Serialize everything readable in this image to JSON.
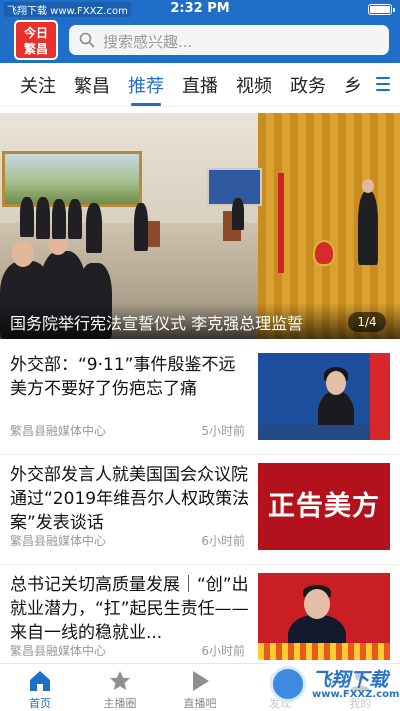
{
  "status_bar": {
    "watermark": "飞翔下载 www.FXXZ.com",
    "time": "2:32 PM"
  },
  "header": {
    "logo_line1": "今日",
    "logo_line2": "繁昌",
    "search_placeholder": "搜索感兴趣..."
  },
  "tabs": [
    {
      "label": "关注",
      "active": false
    },
    {
      "label": "繁昌",
      "active": false
    },
    {
      "label": "推荐",
      "active": true
    },
    {
      "label": "直播",
      "active": false
    },
    {
      "label": "视频",
      "active": false
    },
    {
      "label": "政务",
      "active": false
    },
    {
      "label": "乡",
      "active": false
    }
  ],
  "banner": {
    "caption": "国务院举行宪法宣誓仪式 李克强总理监誓",
    "pager": "1/4"
  },
  "news": [
    {
      "title": "外交部：“9·11”事件殷鉴不远 美方不要好了伤疤忘了痛",
      "source": "繁昌县融媒体中心",
      "time": "5小时前",
      "thumb": "spokesperson-photo"
    },
    {
      "title": "外交部发言人就美国国会众议院通过“2019年维吾尔人权政策法案”发表谈话",
      "source": "繁昌县融媒体中心",
      "time": "6小时前",
      "thumb_text": "正告美方"
    },
    {
      "title": "总书记关切高质量发展｜“创”出就业潜力，“扛”起民生责任——来自一线的稳就业...",
      "source": "繁昌县融媒体中心",
      "time": "6小时前",
      "thumb": "leader-photo"
    }
  ],
  "tabbar": [
    {
      "label": "首页",
      "icon": "home-icon",
      "active": true
    },
    {
      "label": "主播圈",
      "icon": "star-icon",
      "active": false
    },
    {
      "label": "直播吧",
      "icon": "play-icon",
      "active": false
    },
    {
      "label": "发现",
      "icon": "compass-icon",
      "active": false
    },
    {
      "label": "我的",
      "icon": "person-icon",
      "active": false
    }
  ],
  "footer_watermark": {
    "title": "飞翔下载",
    "url": "www.FXXZ.com"
  },
  "colors": {
    "brand_blue": "#1f6fc9",
    "logo_red": "#e9312a"
  }
}
